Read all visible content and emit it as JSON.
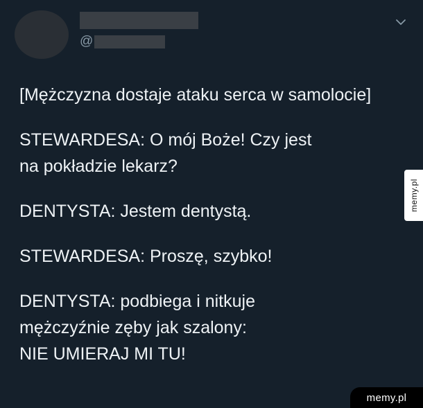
{
  "tweet": {
    "handle_prefix": "@",
    "menu_icon": "chevron-down-icon",
    "lines": [
      [
        "[Mężczyzna dostaje ataku serca w samolocie]"
      ],
      [
        "STEWARDESA: O mój Boże! Czy jest",
        "na pokładzie lekarz?"
      ],
      [
        "DENTYSTA: Jestem dentystą."
      ],
      [
        "STEWARDESA: Proszę, szybko!"
      ],
      [
        "DENTYSTA: podbiega i nitkuje",
        "mężczyźnie zęby jak szalony:",
        "NIE UMIERAJ MI TU!"
      ]
    ]
  },
  "watermark": {
    "side": "memy.pl",
    "bottom": "memy.pl"
  },
  "colors": {
    "background": "#15202b",
    "text": "#eef2f5",
    "muted": "#8899a6"
  }
}
